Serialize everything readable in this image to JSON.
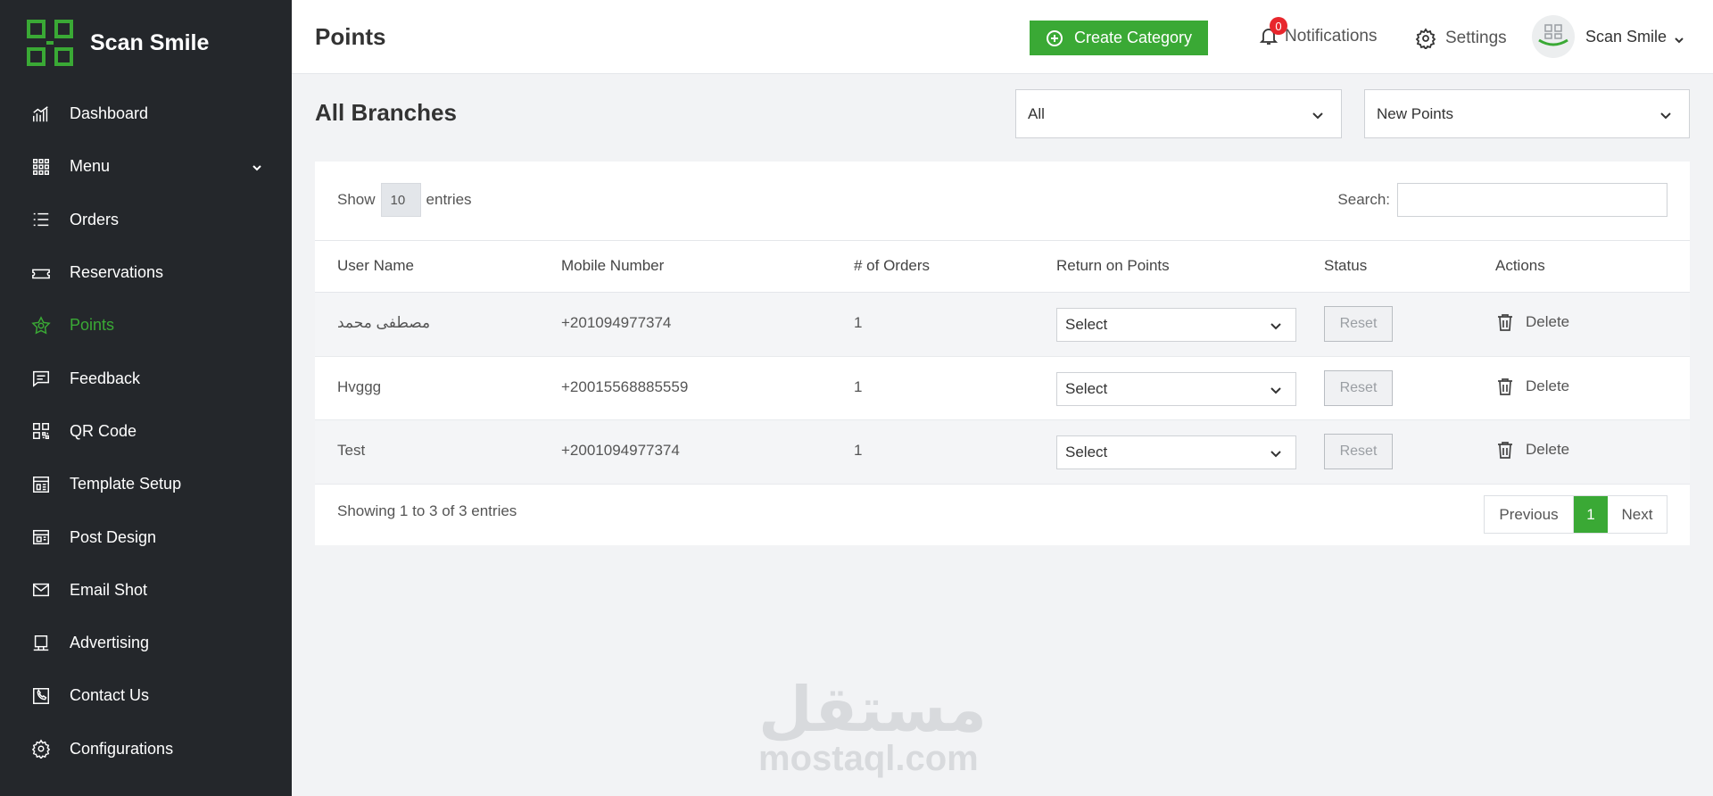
{
  "app": {
    "brand_name": "Scan Smile"
  },
  "sidebar": {
    "items": [
      {
        "label": "Dashboard",
        "icon": "chart-icon"
      },
      {
        "label": "Menu",
        "icon": "grid-icon",
        "has_submenu": true
      },
      {
        "label": "Orders",
        "icon": "list-icon"
      },
      {
        "label": "Reservations",
        "icon": "ticket-icon"
      },
      {
        "label": "Points",
        "icon": "star-icon",
        "active": true
      },
      {
        "label": "Feedback",
        "icon": "message-icon"
      },
      {
        "label": "QR Code",
        "icon": "qrcode-icon"
      },
      {
        "label": "Template Setup",
        "icon": "template-icon"
      },
      {
        "label": "Post Design",
        "icon": "layout-icon"
      },
      {
        "label": "Email Shot",
        "icon": "mail-icon"
      },
      {
        "label": "Advertising",
        "icon": "monitor-icon"
      },
      {
        "label": "Contact Us",
        "icon": "phone-icon"
      },
      {
        "label": "Configurations",
        "icon": "gear-icon"
      }
    ]
  },
  "header": {
    "page_title": "Points",
    "create_button": "Create Category",
    "notifications_label": "Notifications",
    "notifications_count": "0",
    "settings_label": "Settings",
    "user_name": "Scan Smile"
  },
  "filters": {
    "section_title": "All Branches",
    "branch_value": "All",
    "points_value": "New Points"
  },
  "table_controls": {
    "show_label": "Show",
    "entries_value": "10",
    "entries_label": "entries",
    "search_label": "Search:",
    "search_value": ""
  },
  "table": {
    "columns": [
      "User Name",
      "Mobile Number",
      "# of Orders",
      "Return on Points",
      "Status",
      "Actions"
    ],
    "rows": [
      {
        "user_name": "مصطفى محمد",
        "mobile": "+201094977374",
        "orders": "1",
        "return_on_points": "Select",
        "status_button": "Reset",
        "action": "Delete"
      },
      {
        "user_name": "Hvggg",
        "mobile": "+20015568885559",
        "orders": "1",
        "return_on_points": "Select",
        "status_button": "Reset",
        "action": "Delete"
      },
      {
        "user_name": "Test",
        "mobile": "+2001094977374",
        "orders": "1",
        "return_on_points": "Select",
        "status_button": "Reset",
        "action": "Delete"
      }
    ]
  },
  "pagination": {
    "info": "Showing 1 to 3 of 3 entries",
    "previous": "Previous",
    "current": "1",
    "next": "Next"
  },
  "watermark": {
    "arabic": "مستقل",
    "latin": "mostaql.com"
  },
  "colors": {
    "accent": "#3aa935",
    "sidebar_bg": "#24272b",
    "badge": "#e8262c"
  }
}
